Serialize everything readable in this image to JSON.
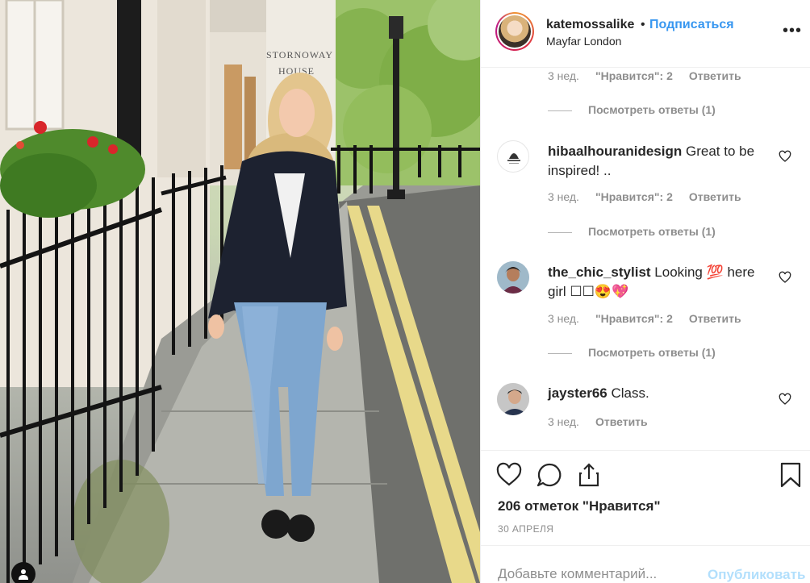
{
  "post": {
    "username": "katemossalike",
    "follow_label": "Подписаться",
    "separator": "•",
    "location": "Mayfar London",
    "more_icon": "more-options-icon",
    "photo_sign_line1": "STORNOWAY",
    "photo_sign_line2": "HOUSE"
  },
  "comments": [
    {
      "username": "",
      "text": "",
      "age": "3 нед.",
      "likes": "\"Нравится\": 2",
      "reply_label": "Ответить",
      "view_replies": "Посмотреть ответы (1)"
    },
    {
      "username": "hibaalhouranidesign",
      "text": "Great to be inspired! ..",
      "age": "3 нед.",
      "likes": "\"Нравится\": 2",
      "reply_label": "Ответить",
      "view_replies": "Посмотреть ответы (1)"
    },
    {
      "username": "the_chic_stylist",
      "text": "Looking 💯 here girl ☐☐😍💖",
      "age": "3 нед.",
      "likes": "\"Нравится\": 2",
      "reply_label": "Ответить",
      "view_replies": "Посмотреть ответы (1)"
    },
    {
      "username": "jayster66",
      "text": "Class.",
      "age": "3 нед.",
      "reply_label": "Ответить"
    }
  ],
  "actions": {
    "like_count": "206 отметок \"Нравится\"",
    "date": "30 АПРЕЛЯ",
    "comment_placeholder": "Добавьте комментарий...",
    "publish_label": "Опубликовать"
  },
  "colors": {
    "link_blue": "#3897f0",
    "muted": "#8e8e8e",
    "publish_disabled": "#b2dffc"
  }
}
